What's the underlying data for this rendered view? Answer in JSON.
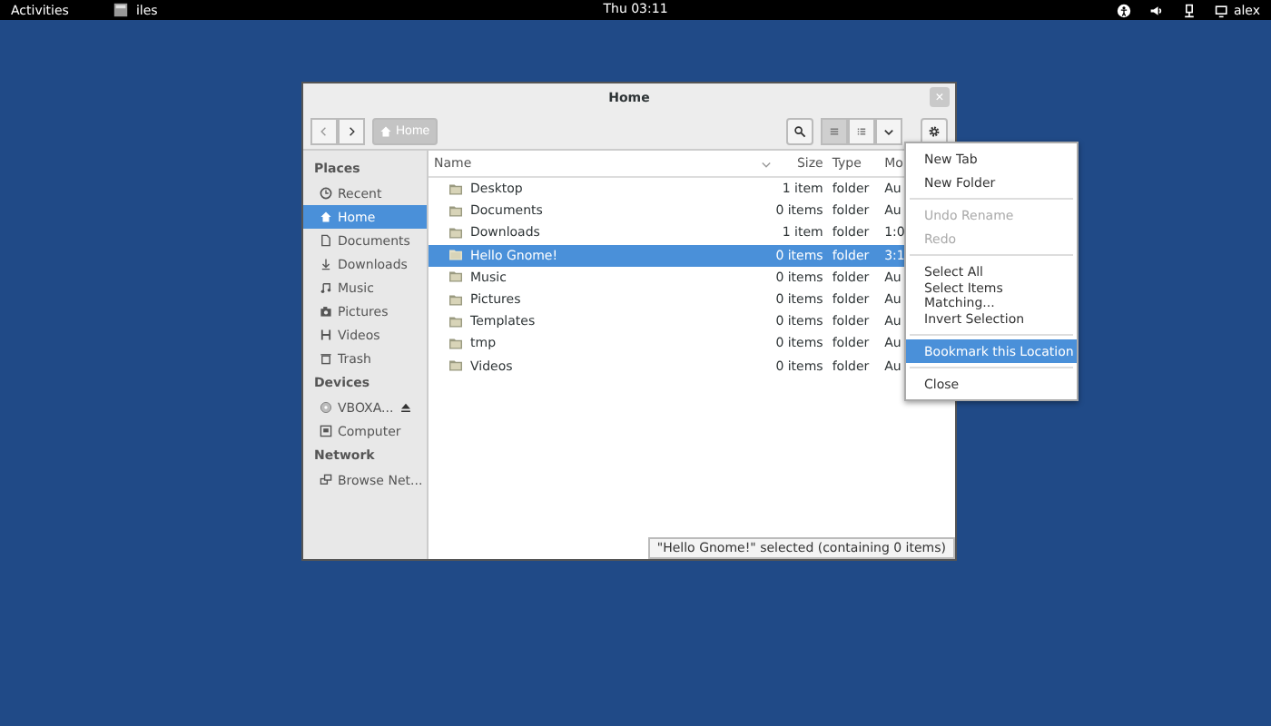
{
  "top_bar": {
    "activities": "Activities",
    "app_name": "iles",
    "clock": "Thu 03:11",
    "user": "alex"
  },
  "window": {
    "title": "Home",
    "close": "×"
  },
  "toolbar": {
    "path": "Home",
    "views": [
      {
        "kind": "list",
        "selected": true
      },
      {
        "kind": "grid",
        "selected": false
      }
    ]
  },
  "sidebar": {
    "sections": [
      {
        "heading": "Places",
        "items": [
          {
            "label": "Recent",
            "selected": false
          },
          {
            "label": "Home",
            "selected": true
          },
          {
            "label": "Documents",
            "selected": false
          },
          {
            "label": "Downloads",
            "selected": false
          },
          {
            "label": "Music",
            "selected": false
          },
          {
            "label": "Pictures",
            "selected": false
          },
          {
            "label": "Videos",
            "selected": false
          },
          {
            "label": "Trash",
            "selected": false
          }
        ]
      },
      {
        "heading": "Devices",
        "items": [
          {
            "label": "VBOXA...",
            "selected": false,
            "eject": true
          },
          {
            "label": "Computer",
            "selected": false
          }
        ]
      },
      {
        "heading": "Network",
        "items": [
          {
            "label": "Browse Net...",
            "selected": false
          }
        ]
      }
    ]
  },
  "table": {
    "columns": [
      "Name",
      "Size",
      "Type",
      "Mo"
    ],
    "rows": [
      {
        "name": "Desktop",
        "size": "1 item",
        "type": "folder",
        "modified": "Au",
        "selected": false
      },
      {
        "name": "Documents",
        "size": "0 items",
        "type": "folder",
        "modified": "Au",
        "selected": false
      },
      {
        "name": "Downloads",
        "size": "1 item",
        "type": "folder",
        "modified": "1:0",
        "selected": false
      },
      {
        "name": "Hello Gnome!",
        "size": "0 items",
        "type": "folder",
        "modified": "3:1",
        "selected": true
      },
      {
        "name": "Music",
        "size": "0 items",
        "type": "folder",
        "modified": "Au",
        "selected": false
      },
      {
        "name": "Pictures",
        "size": "0 items",
        "type": "folder",
        "modified": "Au",
        "selected": false
      },
      {
        "name": "Templates",
        "size": "0 items",
        "type": "folder",
        "modified": "Au",
        "selected": false
      },
      {
        "name": "tmp",
        "size": "0 items",
        "type": "folder",
        "modified": "Au",
        "selected": false
      },
      {
        "name": "Videos",
        "size": "0 items",
        "type": "folder",
        "modified": "Au",
        "selected": false
      }
    ]
  },
  "status": "\"Hello Gnome!\" selected (containing 0 items)",
  "menu": {
    "groups": [
      [
        {
          "label": "New Tab",
          "disabled": false,
          "selected": false
        },
        {
          "label": "New Folder",
          "disabled": false,
          "selected": false
        }
      ],
      [
        {
          "label": "Undo Rename",
          "disabled": true,
          "selected": false
        },
        {
          "label": "Redo",
          "disabled": true,
          "selected": false
        }
      ],
      [
        {
          "label": "Select All",
          "disabled": false,
          "selected": false
        },
        {
          "label": "Select Items Matching...",
          "disabled": false,
          "selected": false
        },
        {
          "label": "Invert Selection",
          "disabled": false,
          "selected": false
        }
      ],
      [
        {
          "label": "Bookmark this Location",
          "disabled": false,
          "selected": true
        }
      ],
      [
        {
          "label": "Close",
          "disabled": false,
          "selected": false
        }
      ]
    ]
  }
}
